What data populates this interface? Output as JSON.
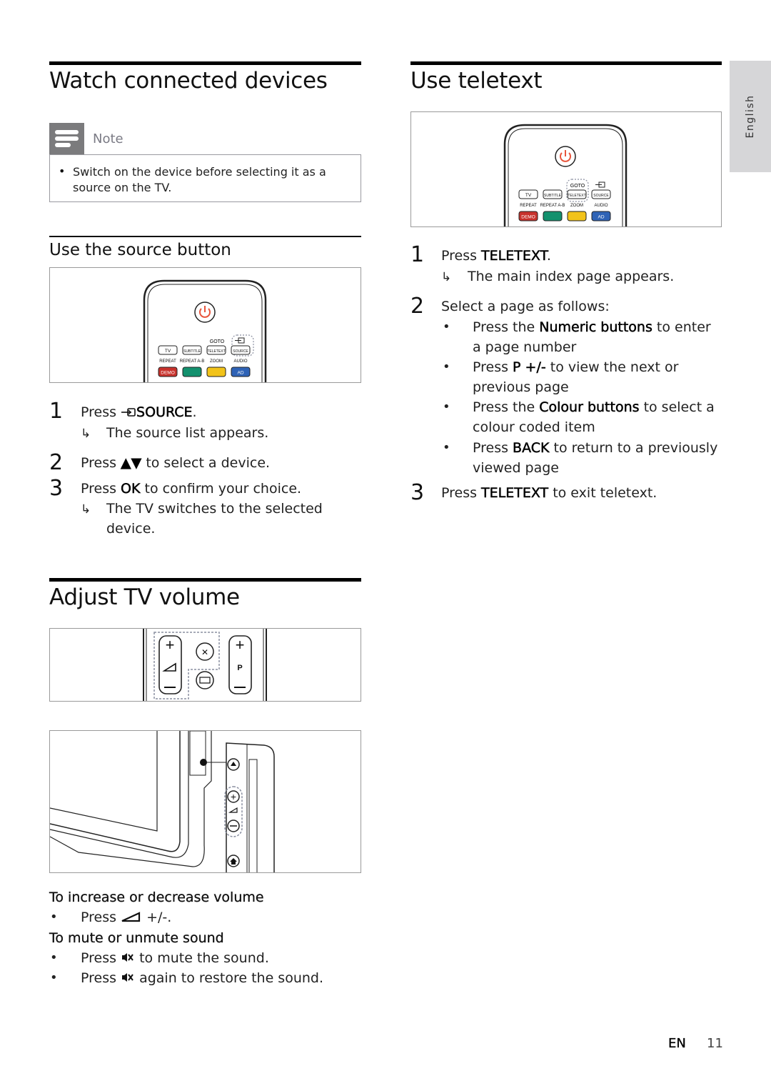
{
  "side_tab": {
    "label": "English"
  },
  "left": {
    "section1": {
      "title": "Watch connected devices",
      "note": {
        "label": "Note",
        "icon": "note-icon",
        "bullet": "•",
        "text": "Switch on the device before selecting it as a source on the TV."
      },
      "subsection": {
        "title": "Use the source button",
        "steps": [
          {
            "num": "1",
            "prefix": "Press ",
            "icon": "source-icon",
            "bold": "SOURCE",
            "suffix": ".",
            "result": "The source list appears."
          },
          {
            "num": "2",
            "prefix": "Press ",
            "bold": "▲▼",
            "suffix": " to select a device."
          },
          {
            "num": "3",
            "prefix": "Press ",
            "bold": "OK",
            "suffix": " to confirm your choice.",
            "result_line1": "The TV switches to the selected",
            "result_line2": "device."
          }
        ]
      }
    },
    "section2": {
      "title": "Adjust TV volume",
      "increase_heading": "To increase or decrease volume",
      "increase_bullet": {
        "prefix": "Press ",
        "icon": "volume-icon",
        "suffix": " +/-."
      },
      "mute_heading": "To mute or unmute sound",
      "mute_bullets": [
        {
          "prefix": "Press ",
          "icon": "mute-icon",
          "suffix": " to mute the sound."
        },
        {
          "prefix": "Press ",
          "icon": "mute-icon",
          "suffix": " again to restore the sound."
        }
      ]
    }
  },
  "right": {
    "section": {
      "title": "Use teletext",
      "steps": {
        "s1": {
          "num": "1",
          "prefix": "Press ",
          "bold": "TELETEXT",
          "suffix": ".",
          "result": "The main index page appears."
        },
        "s2": {
          "num": "2",
          "text": "Select a page as follows:",
          "bullets": [
            {
              "prefix": "Press the ",
              "bold": "Numeric buttons",
              "suffix": " to enter",
              "cont": "a page number"
            },
            {
              "prefix": "Press ",
              "bold": "P +/-",
              "suffix": " to view the next or",
              "cont": "previous page"
            },
            {
              "prefix": "Press the ",
              "bold": "Colour buttons",
              "suffix": " to select a",
              "cont": "colour coded item"
            },
            {
              "prefix": "Press ",
              "bold": "BACK",
              "suffix": " to return to a previously",
              "cont": "viewed page"
            }
          ]
        },
        "s3": {
          "num": "3",
          "prefix": "Press ",
          "bold": "TELETEXT",
          "suffix": " to exit teletext."
        }
      }
    }
  },
  "remote": {
    "goto": "GOTO",
    "buttons": [
      "TV",
      "SUBTITLE",
      "TELETEXT",
      "SOURCE"
    ],
    "sublabels": [
      "REPEAT",
      "REPEAT A-B",
      "ZOOM",
      "AUDIO"
    ],
    "color_buttons": [
      {
        "label": "DEMO",
        "color": "#c8322c"
      },
      {
        "label": "",
        "color": "#13916e"
      },
      {
        "label": "",
        "color": "#f2c31a"
      },
      {
        "label": "AD",
        "color": "#2f63b6"
      }
    ],
    "power_color": "#e8553c",
    "p_label": "P"
  },
  "footer": {
    "lang": "EN",
    "page": "11"
  },
  "bullet_glyph": "•",
  "arrow_glyph": "↳"
}
